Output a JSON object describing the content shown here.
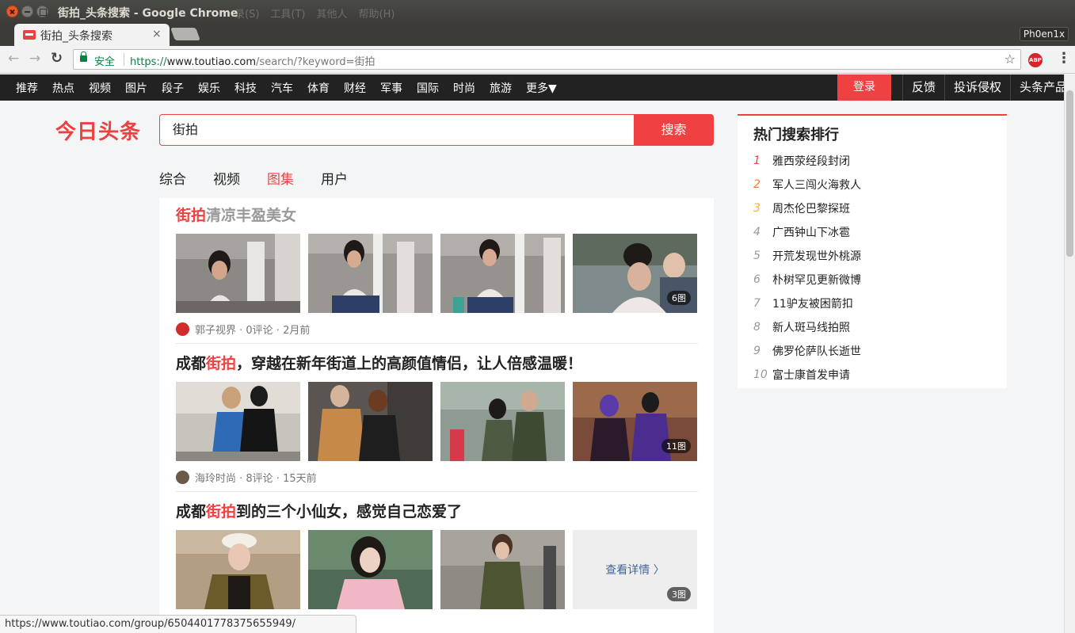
{
  "window": {
    "title": "街拍_头条搜索 - Google Chrome",
    "ghost_menu": [
      "录(S)",
      "工具(T)",
      "其他人",
      "帮助(H)"
    ]
  },
  "tab": {
    "title": "街拍_头条搜索",
    "close": "×"
  },
  "profile": "Ph0en1x",
  "toolbar": {
    "back": "←",
    "forward": "→",
    "reload": "↻",
    "secure_label": "安全",
    "url_scheme": "https://",
    "url_host": "www.toutiao.com",
    "url_path": "/search/?keyword=街拍",
    "star": "☆",
    "abp": "ABP",
    "menu": "⋮"
  },
  "sitenav": {
    "items": [
      "推荐",
      "热点",
      "视频",
      "图片",
      "段子",
      "娱乐",
      "科技",
      "汽车",
      "体育",
      "财经",
      "军事",
      "国际",
      "时尚",
      "旅游"
    ],
    "more": "更多",
    "login": "登录",
    "right": [
      "反馈",
      "投诉侵权",
      "头条产品"
    ]
  },
  "logo": "今日头条",
  "search": {
    "value": "街拍",
    "button": "搜索"
  },
  "filter_tabs": [
    "综合",
    "视频",
    "图集",
    "用户"
  ],
  "results": [
    {
      "title_hl": "街拍",
      "title_rest": "清凉丰盈美女",
      "badge": "6图",
      "meta": "郭子视界 · 0评论 · 2月前"
    },
    {
      "title_pre": "成都",
      "title_hl": "街拍",
      "title_rest": "，穿越在新年街道上的高颜值情侣，让人倍感温暖！",
      "badge": "11图",
      "meta": "海玲时尚 · 8评论 · 15天前"
    },
    {
      "title_pre": "成都",
      "title_hl": "街拍",
      "title_rest": "到的三个小仙女，感觉自己恋爱了",
      "badge": "3图",
      "more_link": "查看详情 〉"
    }
  ],
  "hot": {
    "title": "热门搜索排行",
    "items": [
      {
        "rank": "1",
        "text": "雅西荥经段封闭",
        "color": "#f04142"
      },
      {
        "rank": "2",
        "text": "军人三闯火海救人",
        "color": "#ff7b24"
      },
      {
        "rank": "3",
        "text": "周杰伦巴黎探班",
        "color": "#ffb21f"
      },
      {
        "rank": "4",
        "text": "广西钟山下冰雹",
        "color": "#999999"
      },
      {
        "rank": "5",
        "text": "开荒发现世外桃源",
        "color": "#999999"
      },
      {
        "rank": "6",
        "text": "朴树罕见更新微博",
        "color": "#999999"
      },
      {
        "rank": "7",
        "text": "11驴友被困箭扣",
        "color": "#999999"
      },
      {
        "rank": "8",
        "text": "新人斑马线拍照",
        "color": "#999999"
      },
      {
        "rank": "9",
        "text": "佛罗伦萨队长逝世",
        "color": "#999999"
      },
      {
        "rank": "10",
        "text": "富士康首发申请",
        "color": "#999999"
      }
    ]
  },
  "statusbar": "https://www.toutiao.com/group/6504401778375655949/",
  "colors": {
    "accent": "#f04142",
    "nav_bg": "#222222",
    "link": "#406599"
  }
}
